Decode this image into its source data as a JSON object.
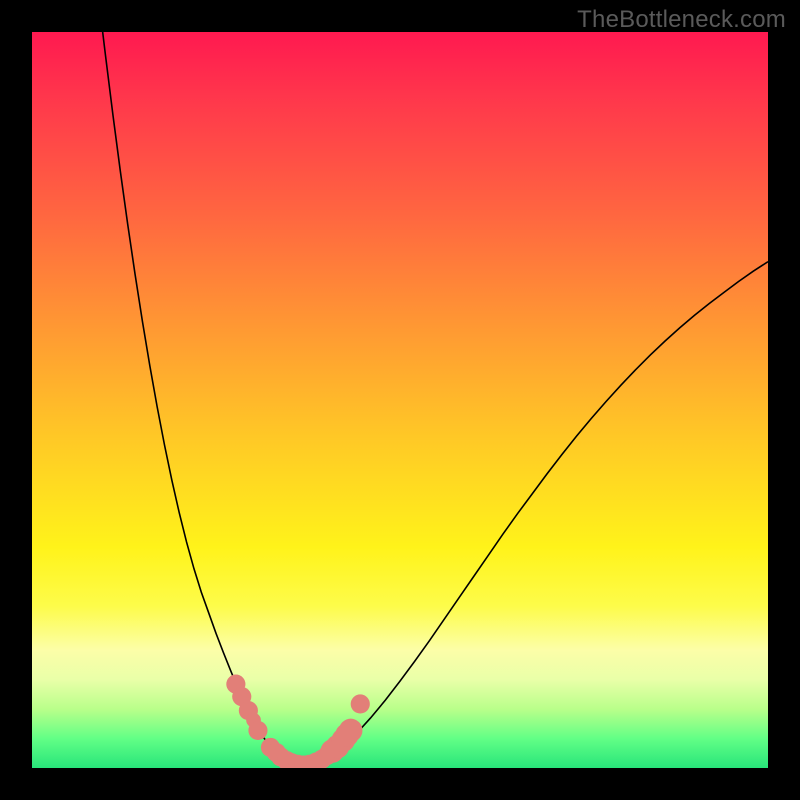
{
  "watermark": "TheBottleneck.com",
  "chart_data": {
    "type": "line",
    "title": "",
    "xlabel": "",
    "ylabel": "",
    "xlim": [
      0,
      100
    ],
    "ylim": [
      0,
      100
    ],
    "series": [
      {
        "name": "left-curve",
        "x": [
          9.6,
          10,
          11,
          12,
          13,
          14,
          15,
          16,
          17,
          18,
          19,
          20,
          21,
          22,
          23,
          24,
          25,
          26,
          27,
          27.5,
          28,
          28.5,
          29,
          29.5,
          30,
          30.5,
          31,
          31.5,
          32,
          32.5,
          33,
          33.5,
          34,
          34.5,
          35
        ],
        "values": [
          100,
          96.7,
          88.7,
          81.1,
          73.9,
          67.1,
          60.7,
          54.7,
          49.1,
          43.9,
          39.1,
          34.7,
          30.7,
          27.1,
          23.9,
          21.1,
          18.3,
          15.7,
          13.2,
          12.0,
          10.8,
          9.7,
          8.6,
          7.6,
          6.6,
          5.7,
          4.9,
          4.1,
          3.4,
          2.8,
          2.2,
          1.7,
          1.2,
          0.8,
          0.5
        ]
      },
      {
        "name": "valley-floor",
        "x": [
          35,
          36,
          37,
          38
        ],
        "values": [
          0.5,
          0.3,
          0.3,
          0.5
        ]
      },
      {
        "name": "right-curve",
        "x": [
          38,
          39,
          40,
          41,
          42,
          44,
          46,
          48,
          50,
          52,
          54,
          56,
          58,
          60,
          62,
          64,
          66,
          68,
          70,
          72,
          74,
          76,
          78,
          80,
          82,
          84,
          86,
          88,
          90,
          92,
          94,
          96,
          98,
          100
        ],
        "values": [
          0.5,
          0.9,
          1.4,
          2.0,
          2.8,
          4.6,
          6.8,
          9.2,
          11.8,
          14.5,
          17.3,
          20.2,
          23.1,
          26.0,
          28.9,
          31.8,
          34.6,
          37.3,
          40.0,
          42.6,
          45.1,
          47.5,
          49.8,
          52.0,
          54.1,
          56.1,
          58.0,
          59.8,
          61.5,
          63.1,
          64.6,
          66.1,
          67.5,
          68.8
        ]
      }
    ],
    "markers": {
      "name": "highlight-points",
      "shape": "circle",
      "color": "#e27f78",
      "points": [
        {
          "x": 27.7,
          "y": 11.4,
          "r": 1.3
        },
        {
          "x": 28.5,
          "y": 9.7,
          "r": 1.3
        },
        {
          "x": 29.4,
          "y": 7.8,
          "r": 1.3
        },
        {
          "x": 30.1,
          "y": 6.5,
          "r": 1.0
        },
        {
          "x": 30.7,
          "y": 5.1,
          "r": 1.3
        },
        {
          "x": 32.4,
          "y": 2.8,
          "r": 1.3
        },
        {
          "x": 33.2,
          "y": 2.1,
          "r": 1.3
        },
        {
          "x": 33.8,
          "y": 1.5,
          "r": 1.3
        },
        {
          "x": 34.6,
          "y": 1.0,
          "r": 1.3
        },
        {
          "x": 35.3,
          "y": 0.7,
          "r": 1.3
        },
        {
          "x": 36.1,
          "y": 0.5,
          "r": 1.3
        },
        {
          "x": 36.9,
          "y": 0.4,
          "r": 1.3
        },
        {
          "x": 37.7,
          "y": 0.5,
          "r": 1.3
        },
        {
          "x": 38.6,
          "y": 0.8,
          "r": 1.3
        },
        {
          "x": 39.4,
          "y": 1.2,
          "r": 1.3
        },
        {
          "x": 40.1,
          "y": 1.7,
          "r": 1.3
        },
        {
          "x": 40.8,
          "y": 2.3,
          "r": 1.6
        },
        {
          "x": 41.5,
          "y": 2.9,
          "r": 1.6
        },
        {
          "x": 42.3,
          "y": 3.8,
          "r": 1.6
        },
        {
          "x": 42.8,
          "y": 4.5,
          "r": 1.6
        },
        {
          "x": 43.3,
          "y": 5.1,
          "r": 1.6
        },
        {
          "x": 44.6,
          "y": 8.7,
          "r": 1.3
        }
      ]
    }
  }
}
